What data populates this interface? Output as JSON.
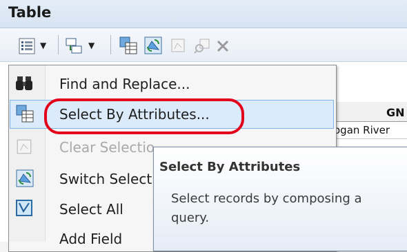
{
  "window": {
    "title": "Table"
  },
  "toolbar": {
    "buttons": [
      {
        "icon": "table-options-icon",
        "has_dropdown": true
      },
      {
        "icon": "related-tables-icon",
        "has_dropdown": true
      },
      {
        "icon": "select-by-attributes-icon"
      },
      {
        "icon": "switch-selection-icon"
      },
      {
        "icon": "clear-selection-icon"
      },
      {
        "icon": "zoom-to-selected-icon"
      },
      {
        "icon": "delete-selected-icon"
      }
    ]
  },
  "table": {
    "columns": [
      "GN"
    ],
    "rows": [
      [
        "ogan River"
      ]
    ]
  },
  "menu": {
    "items": [
      {
        "label": "Find and Replace...",
        "icon": "binoculars-icon",
        "enabled": true
      },
      {
        "label": "Select By Attributes...",
        "icon": "select-by-attributes-icon",
        "enabled": true,
        "highlighted": true
      },
      {
        "label": "Clear Selectio",
        "icon": "clear-selection-icon",
        "enabled": false
      },
      {
        "label": "Switch Select",
        "icon": "switch-selection-icon",
        "enabled": true
      },
      {
        "label": "Select All",
        "icon": "select-all-icon",
        "enabled": true
      },
      {
        "label": "Add Field",
        "icon": "",
        "enabled": true
      }
    ]
  },
  "tooltip": {
    "title": "Select By Attributes",
    "body": "Select records by composing a query."
  },
  "colors": {
    "highlight": "#dcebfb",
    "annotation": "#e3001b"
  }
}
